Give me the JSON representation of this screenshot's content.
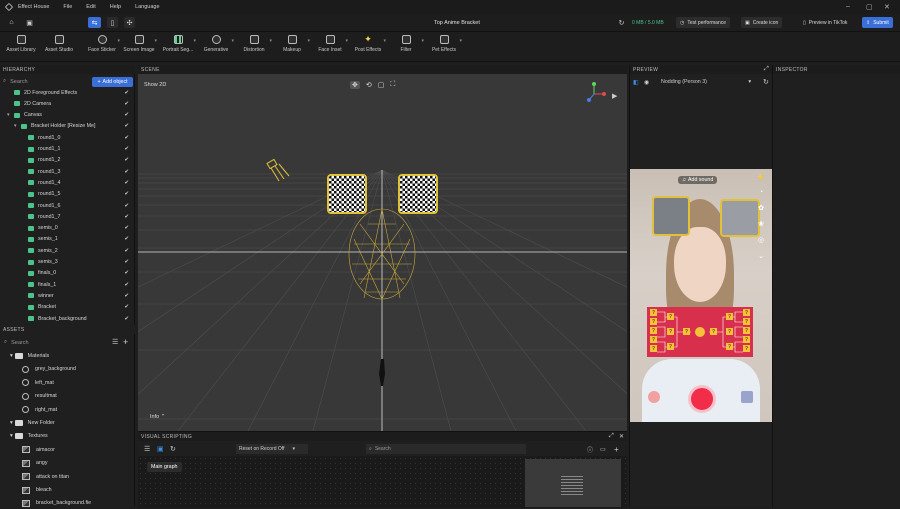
{
  "menu": {
    "app": "Effect House",
    "items": [
      "File",
      "Edit",
      "Help",
      "Language"
    ]
  },
  "toolbar": {
    "title": "Top Anime Bracket",
    "storage": "0 MB / 5.0 MB",
    "test_performance": "Test performance",
    "create_icon": "Create icon",
    "preview_tiktok": "Preview in TikTok",
    "submit": "Submit"
  },
  "assetbar": [
    "Asset Library",
    "Asset Studio",
    "Face Sticker",
    "Screen Image",
    "Portrait Seg...",
    "Generative",
    "Distortion",
    "Makeup",
    "Face Inset",
    "Post Effects",
    "Filter",
    "Pet Effects"
  ],
  "hierarchy": {
    "title": "HIERARCHY",
    "search_placeholder": "Search",
    "add_object": "Add object",
    "items": [
      {
        "label": "2D Foreground Effects",
        "indent": 1,
        "expand": ""
      },
      {
        "label": "2D Camera",
        "indent": 1,
        "expand": ""
      },
      {
        "label": "Canvas",
        "indent": 1,
        "expand": "▾"
      },
      {
        "label": "Bracket Holder [Resize Me]",
        "indent": 2,
        "expand": "▾"
      },
      {
        "label": "round1_0",
        "indent": 3,
        "expand": ""
      },
      {
        "label": "round1_1",
        "indent": 3,
        "expand": ""
      },
      {
        "label": "round1_2",
        "indent": 3,
        "expand": ""
      },
      {
        "label": "round1_3",
        "indent": 3,
        "expand": ""
      },
      {
        "label": "round1_4",
        "indent": 3,
        "expand": ""
      },
      {
        "label": "round1_5",
        "indent": 3,
        "expand": ""
      },
      {
        "label": "round1_6",
        "indent": 3,
        "expand": ""
      },
      {
        "label": "round1_7",
        "indent": 3,
        "expand": ""
      },
      {
        "label": "semis_0",
        "indent": 3,
        "expand": ""
      },
      {
        "label": "semis_1",
        "indent": 3,
        "expand": ""
      },
      {
        "label": "semis_2",
        "indent": 3,
        "expand": ""
      },
      {
        "label": "semis_3",
        "indent": 3,
        "expand": ""
      },
      {
        "label": "finals_0",
        "indent": 3,
        "expand": ""
      },
      {
        "label": "finals_1",
        "indent": 3,
        "expand": ""
      },
      {
        "label": "winner",
        "indent": 3,
        "expand": ""
      },
      {
        "label": "Bracket",
        "indent": 3,
        "expand": ""
      },
      {
        "label": "Bracket_background",
        "indent": 3,
        "expand": ""
      }
    ]
  },
  "assets": {
    "title": "ASSETS",
    "search_placeholder": "Search",
    "items": [
      {
        "label": "Materials",
        "kind": "folder",
        "indent": 1
      },
      {
        "label": "grey_background",
        "kind": "material",
        "indent": 2
      },
      {
        "label": "left_mat",
        "kind": "material",
        "indent": 2
      },
      {
        "label": "resultmat",
        "kind": "material",
        "indent": 2
      },
      {
        "label": "right_mat",
        "kind": "material",
        "indent": 2
      },
      {
        "label": "New Folder",
        "kind": "folder",
        "indent": 1
      },
      {
        "label": "Textures",
        "kind": "folder",
        "indent": 1
      },
      {
        "label": "aimacor",
        "kind": "texture",
        "indent": 2
      },
      {
        "label": "angy",
        "kind": "texture",
        "indent": 2
      },
      {
        "label": "attack on titan",
        "kind": "texture",
        "indent": 2
      },
      {
        "label": "bleach",
        "kind": "texture",
        "indent": 2
      },
      {
        "label": "bracket_background.fie",
        "kind": "texture",
        "indent": 2
      }
    ]
  },
  "scene": {
    "title": "SCENE",
    "show2d": "Show 2D",
    "info": "Info"
  },
  "visual_scripting": {
    "title": "VISUAL SCRIPTING",
    "record": "Reset on Record Off",
    "search_placeholder": "Search",
    "main_graph": "Main graph"
  },
  "preview": {
    "title": "PREVIEW",
    "mode": "Nodding (Person 3)",
    "add_sound": "Add sound"
  },
  "inspector": {
    "title": "INSPECTOR"
  },
  "colors": {
    "accent": "#3a6fd8",
    "hier_icon": "#4cc38a",
    "frame_gold": "#e2c13a",
    "bracket_red": "#d8304c",
    "record_red": "#f12d4a"
  }
}
